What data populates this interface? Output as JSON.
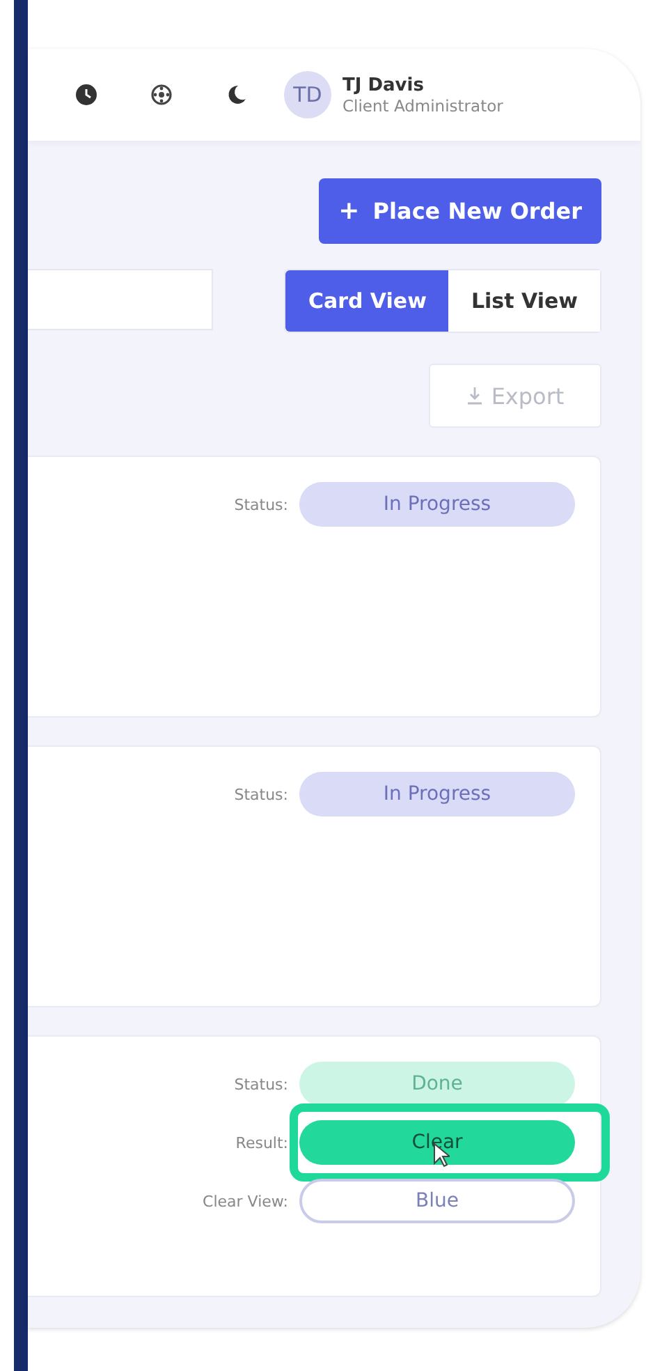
{
  "header": {
    "avatar": "TD",
    "user_name": "TJ Davis",
    "user_role": "Client Administrator"
  },
  "place_order_button": {
    "icon": "+",
    "label": "Place New Order"
  },
  "view_toggle": [
    {
      "label": "Card View",
      "selected": true
    },
    {
      "label": "List View",
      "selected": false
    }
  ],
  "export_button": {
    "label": "Export",
    "disabled": true
  },
  "cards": [
    {
      "fields": [
        {
          "label": "Status:",
          "value": "In Progress",
          "kind": "soft",
          "color": "#d9dbf7",
          "highlighted": false
        }
      ]
    },
    {
      "fields": [
        {
          "label": "Status:",
          "value": "In Progress",
          "kind": "soft",
          "color": "#d9dbf7",
          "highlighted": false
        }
      ]
    },
    {
      "fields": [
        {
          "label": "Status:",
          "value": "Done",
          "kind": "soft",
          "color": "#cdf5e6",
          "highlighted": false
        },
        {
          "label": "Result:",
          "value": "Clear",
          "kind": "solid",
          "color": "#22d99b",
          "highlighted": true
        },
        {
          "label": "Clear View:",
          "value": "Blue",
          "kind": "outline",
          "color": "#c9cbe8",
          "highlighted": false
        }
      ]
    }
  ]
}
